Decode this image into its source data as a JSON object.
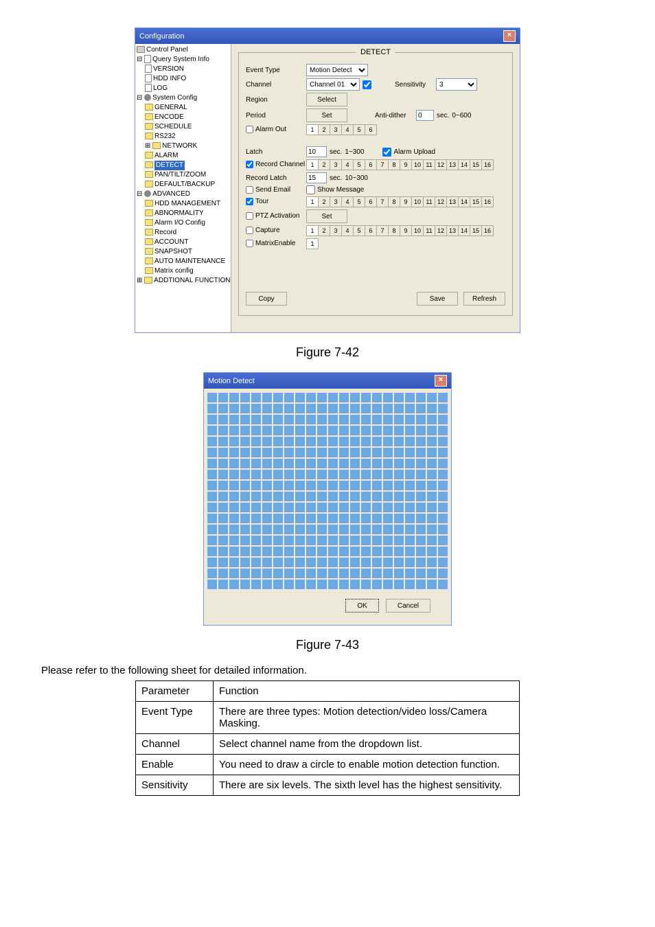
{
  "configWindow": {
    "title": "Configuration",
    "fieldsetLegend": "DETECT",
    "tree": {
      "controlPanel": "Control Panel",
      "querySystemInfo": "Query System Info",
      "version": "VERSION",
      "hddInfo": "HDD INFO",
      "log": "LOG",
      "systemConfig": "System Config",
      "general": "GENERAL",
      "encode": "ENCODE",
      "schedule": "SCHEDULE",
      "rs232": "RS232",
      "network": "NETWORK",
      "alarm": "ALARM",
      "detect": "DETECT",
      "ptz": "PAN/TILT/ZOOM",
      "defaultBackup": "DEFAULT/BACKUP",
      "advanced": "ADVANCED",
      "hddMgmt": "HDD MANAGEMENT",
      "abnormality": "ABNORMALITY",
      "alarmIO": "Alarm I/O Config",
      "record": "Record",
      "account": "ACCOUNT",
      "snapshot": "SNAPSHOT",
      "autoMaint": "AUTO MAINTENANCE",
      "matrixConfig": "Matrix config",
      "additional": "ADDTIONAL FUNCTION"
    },
    "labels": {
      "eventType": "Event Type",
      "channel": "Channel",
      "region": "Region",
      "period": "Period",
      "alarmOut": "Alarm Out",
      "latch": "Latch",
      "recordChannel": "Record Channel",
      "recordLatch": "Record Latch",
      "sendEmail": "Send Email",
      "tour": "Tour",
      "ptzActivation": "PTZ Activation",
      "capture": "Capture",
      "matrixEnable": "MatrixEnable",
      "sensitivity": "Sensitivity",
      "antiDither": "Anti-dither",
      "alarmUpload": "Alarm Upload",
      "showMessage": "Show Message",
      "sec": "sec.",
      "latchRange": "1~300",
      "recordLatchRange": "10~300",
      "antiDitherRange": "0~600"
    },
    "values": {
      "eventType": "Motion Detect",
      "channel": "Channel 01",
      "sensitivity": "3",
      "antiDither": "0",
      "latch": "10",
      "recordLatch": "15"
    },
    "buttons": {
      "select": "Select",
      "set": "Set",
      "set2": "Set",
      "copy": "Copy",
      "save": "Save",
      "refresh": "Refresh"
    },
    "alarmOutChannels": [
      "1",
      "2",
      "3",
      "4",
      "5",
      "6"
    ],
    "channels16": [
      "1",
      "2",
      "3",
      "4",
      "5",
      "6",
      "7",
      "8",
      "9",
      "10",
      "11",
      "12",
      "13",
      "14",
      "15",
      "16"
    ],
    "matrixChannels": [
      "1"
    ]
  },
  "figureCaptions": {
    "fig742": "Figure 7-42",
    "fig743": "Figure 7-43"
  },
  "motionWindow": {
    "title": "Motion Detect",
    "ok": "OK",
    "cancel": "Cancel"
  },
  "docText": "Please refer to the following sheet for detailed information.",
  "paramTable": {
    "headers": [
      "Parameter",
      "Function"
    ],
    "rows": [
      {
        "p": "Event Type",
        "f": "There are three types: Motion detection/video loss/Camera Masking."
      },
      {
        "p": "Channel",
        "f": "Select channel name from the dropdown list."
      },
      {
        "p": "Enable",
        "f": "You need to draw a circle to enable motion detection function."
      },
      {
        "p": "Sensitivity",
        "f": "There are six levels.  The sixth level has the highest sensitivity."
      }
    ]
  }
}
